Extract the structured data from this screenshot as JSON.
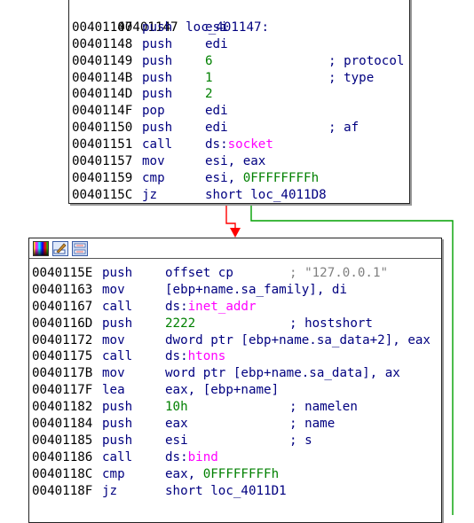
{
  "colors": {
    "address": "#000000",
    "mnemonic": "#000080",
    "number": "#008000",
    "api": "#ff00ff",
    "string_comment": "#808080",
    "edge_false": "#ff0000",
    "edge_true": "#00a000"
  },
  "block1": {
    "label": "loc_401147:",
    "label_address": "00401147",
    "lines": [
      {
        "addr": "00401147",
        "mnem": "push",
        "ops": [
          {
            "t": "esi",
            "c": "plain"
          }
        ],
        "comment": ""
      },
      {
        "addr": "00401148",
        "mnem": "push",
        "ops": [
          {
            "t": "edi",
            "c": "plain"
          }
        ],
        "comment": ""
      },
      {
        "addr": "00401149",
        "mnem": "push",
        "ops": [
          {
            "t": "6",
            "c": "num"
          }
        ],
        "comment": "; protocol"
      },
      {
        "addr": "0040114B",
        "mnem": "push",
        "ops": [
          {
            "t": "1",
            "c": "num"
          }
        ],
        "comment": "; type"
      },
      {
        "addr": "0040114D",
        "mnem": "push",
        "ops": [
          {
            "t": "2",
            "c": "num"
          }
        ],
        "comment": ""
      },
      {
        "addr": "0040114F",
        "mnem": "pop",
        "ops": [
          {
            "t": "edi",
            "c": "plain"
          }
        ],
        "comment": ""
      },
      {
        "addr": "00401150",
        "mnem": "push",
        "ops": [
          {
            "t": "edi",
            "c": "plain"
          }
        ],
        "comment": "; af"
      },
      {
        "addr": "00401151",
        "mnem": "call",
        "ops": [
          {
            "t": "ds:",
            "c": "plain"
          },
          {
            "t": "socket",
            "c": "api"
          }
        ],
        "comment": ""
      },
      {
        "addr": "00401157",
        "mnem": "mov",
        "ops": [
          {
            "t": "esi, eax",
            "c": "plain"
          }
        ],
        "comment": ""
      },
      {
        "addr": "00401159",
        "mnem": "cmp",
        "ops": [
          {
            "t": "esi, ",
            "c": "plain"
          },
          {
            "t": "0FFFFFFFFh",
            "c": "num"
          }
        ],
        "comment": ""
      },
      {
        "addr": "0040115C",
        "mnem": "jz",
        "ops": [
          {
            "t": "short loc_4011D8",
            "c": "plain"
          }
        ],
        "comment": ""
      }
    ]
  },
  "block2": {
    "toolbar": [
      "color-icon",
      "rename-icon",
      "graph-overview-icon"
    ],
    "lines": [
      {
        "addr": "0040115E",
        "mnem": "push",
        "ops": [
          {
            "t": "offset cp",
            "c": "plain"
          }
        ],
        "comment": "; \"127.0.0.1\"",
        "comment_class": "str"
      },
      {
        "addr": "00401163",
        "mnem": "mov",
        "ops": [
          {
            "t": "[ebp+name.sa_family], di",
            "c": "plain"
          }
        ],
        "comment": ""
      },
      {
        "addr": "00401167",
        "mnem": "call",
        "ops": [
          {
            "t": "ds:",
            "c": "plain"
          },
          {
            "t": "inet_addr",
            "c": "api"
          }
        ],
        "comment": ""
      },
      {
        "addr": "0040116D",
        "mnem": "push",
        "ops": [
          {
            "t": "2222",
            "c": "num"
          }
        ],
        "comment": "; hostshort"
      },
      {
        "addr": "00401172",
        "mnem": "mov",
        "ops": [
          {
            "t": "dword ptr [ebp+name.sa_data+2], eax",
            "c": "plain"
          }
        ],
        "comment": ""
      },
      {
        "addr": "00401175",
        "mnem": "call",
        "ops": [
          {
            "t": "ds:",
            "c": "plain"
          },
          {
            "t": "htons",
            "c": "api"
          }
        ],
        "comment": ""
      },
      {
        "addr": "0040117B",
        "mnem": "mov",
        "ops": [
          {
            "t": "word ptr [ebp+name.sa_data], ax",
            "c": "plain"
          }
        ],
        "comment": ""
      },
      {
        "addr": "0040117F",
        "mnem": "lea",
        "ops": [
          {
            "t": "eax, [ebp+name]",
            "c": "plain"
          }
        ],
        "comment": ""
      },
      {
        "addr": "00401182",
        "mnem": "push",
        "ops": [
          {
            "t": "10h",
            "c": "num"
          }
        ],
        "comment": "; namelen"
      },
      {
        "addr": "00401184",
        "mnem": "push",
        "ops": [
          {
            "t": "eax",
            "c": "plain"
          }
        ],
        "comment": "; name"
      },
      {
        "addr": "00401185",
        "mnem": "push",
        "ops": [
          {
            "t": "esi",
            "c": "plain"
          }
        ],
        "comment": "; s"
      },
      {
        "addr": "00401186",
        "mnem": "call",
        "ops": [
          {
            "t": "ds:",
            "c": "plain"
          },
          {
            "t": "bind",
            "c": "api"
          }
        ],
        "comment": ""
      },
      {
        "addr": "0040118C",
        "mnem": "cmp",
        "ops": [
          {
            "t": "eax, ",
            "c": "plain"
          },
          {
            "t": "0FFFFFFFFh",
            "c": "num"
          }
        ],
        "comment": ""
      },
      {
        "addr": "0040118F",
        "mnem": "jz",
        "ops": [
          {
            "t": "short loc_4011D1",
            "c": "plain"
          }
        ],
        "comment": ""
      }
    ]
  }
}
